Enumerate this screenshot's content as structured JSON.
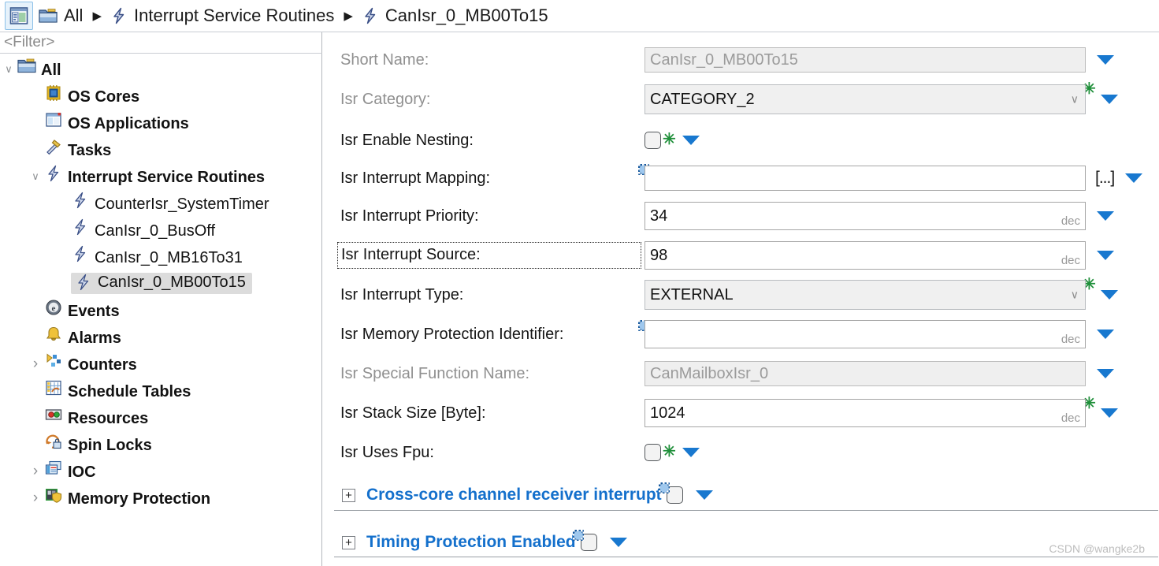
{
  "breadcrumb": {
    "panel_icon": "properties-panel-icon",
    "items": [
      {
        "icon": "folder-icon",
        "label": "All"
      },
      {
        "icon": "isr-lightning-icon",
        "label": "Interrupt Service Routines"
      },
      {
        "icon": "isr-lightning-icon",
        "label": "CanIsr_0_MB00To15"
      }
    ],
    "separator": "▶"
  },
  "sidebar": {
    "filter_placeholder": "<Filter>",
    "tree": [
      {
        "label": "All",
        "icon": "folder-icon",
        "indent": 0,
        "twisty": "open",
        "bold": true,
        "selected": false
      },
      {
        "label": "OS Cores",
        "icon": "cpu-icon",
        "indent": 1,
        "twisty": "none",
        "bold": true,
        "selected": false
      },
      {
        "label": "OS Applications",
        "icon": "application-window-icon",
        "indent": 1,
        "twisty": "none",
        "bold": true,
        "selected": false
      },
      {
        "label": "Tasks",
        "icon": "hammer-icon",
        "indent": 1,
        "twisty": "none",
        "bold": true,
        "selected": false
      },
      {
        "label": "Interrupt Service Routines",
        "icon": "isr-lightning-icon",
        "indent": 1,
        "twisty": "open",
        "bold": true,
        "selected": false
      },
      {
        "label": "CounterIsr_SystemTimer",
        "icon": "isr-lightning-icon",
        "indent": 2,
        "twisty": "none",
        "bold": false,
        "selected": false
      },
      {
        "label": "CanIsr_0_BusOff",
        "icon": "isr-lightning-icon",
        "indent": 2,
        "twisty": "none",
        "bold": false,
        "selected": false
      },
      {
        "label": "CanIsr_0_MB16To31",
        "icon": "isr-lightning-icon",
        "indent": 2,
        "twisty": "none",
        "bold": false,
        "selected": false
      },
      {
        "label": "CanIsr_0_MB00To15",
        "icon": "isr-lightning-icon",
        "indent": 2,
        "twisty": "none",
        "bold": false,
        "selected": true
      },
      {
        "label": "Events",
        "icon": "event-e-icon",
        "indent": 1,
        "twisty": "none",
        "bold": true,
        "selected": false
      },
      {
        "label": "Alarms",
        "icon": "bell-icon",
        "indent": 1,
        "twisty": "none",
        "bold": true,
        "selected": false
      },
      {
        "label": "Counters",
        "icon": "counter-icon",
        "indent": 1,
        "twisty": "closed",
        "bold": true,
        "selected": false
      },
      {
        "label": "Schedule Tables",
        "icon": "schedule-table-icon",
        "indent": 1,
        "twisty": "none",
        "bold": true,
        "selected": false
      },
      {
        "label": "Resources",
        "icon": "resources-icon",
        "indent": 1,
        "twisty": "none",
        "bold": true,
        "selected": false
      },
      {
        "label": "Spin Locks",
        "icon": "spin-lock-icon",
        "indent": 1,
        "twisty": "none",
        "bold": true,
        "selected": false
      },
      {
        "label": "IOC",
        "icon": "ioc-icon",
        "indent": 1,
        "twisty": "closed",
        "bold": true,
        "selected": false
      },
      {
        "label": "Memory Protection",
        "icon": "memory-protection-shield-icon",
        "indent": 1,
        "twisty": "closed",
        "bold": true,
        "selected": false
      }
    ]
  },
  "form": {
    "rows": [
      {
        "name": "short-name",
        "label": "Short Name:",
        "label_dim": true,
        "control": "textbox",
        "value": "CanIsr_0_MB00To15",
        "disabled": true,
        "unit": "",
        "asterisk": false,
        "dropdown": true,
        "vmark": false,
        "ellipsis": false
      },
      {
        "name": "isr-category",
        "label": "Isr Category:",
        "label_dim": true,
        "control": "combo",
        "value": "CATEGORY_2",
        "disabled": false,
        "unit": "",
        "asterisk": true,
        "dropdown": true,
        "vmark": false,
        "ellipsis": false
      },
      {
        "name": "isr-enable-nesting",
        "label": "Isr Enable Nesting:",
        "label_dim": false,
        "control": "checkbox",
        "value": "",
        "checked": false,
        "unit": "",
        "asterisk": true,
        "dropdown": true,
        "vmark": false,
        "ellipsis": false
      },
      {
        "name": "isr-interrupt-mapping",
        "label": "Isr Interrupt Mapping:",
        "label_dim": false,
        "control": "textbox",
        "value": "",
        "disabled": false,
        "unit": "",
        "asterisk": false,
        "dropdown": true,
        "vmark": true,
        "ellipsis": true,
        "ellipsis_label": "[...]"
      },
      {
        "name": "isr-interrupt-priority",
        "label": "Isr Interrupt Priority:",
        "label_dim": false,
        "control": "textbox",
        "value": "34",
        "disabled": false,
        "unit": "dec",
        "asterisk": false,
        "dropdown": true,
        "vmark": false,
        "ellipsis": false
      },
      {
        "name": "isr-interrupt-source",
        "label": "Isr Interrupt Source:",
        "label_dim": false,
        "label_focused": true,
        "control": "textbox",
        "value": "98",
        "disabled": false,
        "unit": "dec",
        "asterisk": false,
        "dropdown": true,
        "vmark": false,
        "ellipsis": false
      },
      {
        "name": "isr-interrupt-type",
        "label": "Isr Interrupt Type:",
        "label_dim": false,
        "control": "combo",
        "value": "EXTERNAL",
        "disabled": false,
        "unit": "",
        "asterisk": true,
        "dropdown": true,
        "vmark": false,
        "ellipsis": false
      },
      {
        "name": "isr-memory-protection-identifier",
        "label": "Isr Memory Protection Identifier:",
        "label_dim": false,
        "control": "textbox",
        "value": "",
        "disabled": false,
        "unit": "dec",
        "asterisk": false,
        "dropdown": true,
        "vmark": true,
        "ellipsis": false
      },
      {
        "name": "isr-special-function-name",
        "label": "Isr Special Function Name:",
        "label_dim": true,
        "control": "textbox",
        "value": "CanMailboxIsr_0",
        "disabled": true,
        "unit": "",
        "asterisk": false,
        "dropdown": true,
        "vmark": false,
        "ellipsis": false
      },
      {
        "name": "isr-stack-size",
        "label": "Isr Stack Size [Byte]:",
        "label_dim": false,
        "control": "textbox",
        "value": "1024",
        "disabled": false,
        "unit": "dec",
        "asterisk": true,
        "dropdown": true,
        "vmark": false,
        "ellipsis": false
      },
      {
        "name": "isr-uses-fpu",
        "label": "Isr Uses Fpu:",
        "label_dim": false,
        "control": "checkbox",
        "value": "",
        "checked": false,
        "unit": "",
        "asterisk": true,
        "dropdown": true,
        "vmark": false,
        "ellipsis": false
      }
    ],
    "expandables": [
      {
        "name": "cross-core-channel-receiver-interrupt",
        "expander": "+",
        "label": "Cross-core channel receiver interrupt",
        "checked": false,
        "vmark": true,
        "dropdown": true
      },
      {
        "name": "timing-protection-enabled",
        "expander": "+",
        "label": "Timing Protection Enabled",
        "checked": false,
        "vmark": true,
        "dropdown": true
      }
    ]
  },
  "watermark": "CSDN @wangke2b",
  "colors": {
    "accent_blue": "#1878cf",
    "link_blue": "#1470cc",
    "asterisk_green": "#1f8f3a",
    "selection_gray": "#dcdcdc",
    "disabled_bg": "#efefef"
  }
}
